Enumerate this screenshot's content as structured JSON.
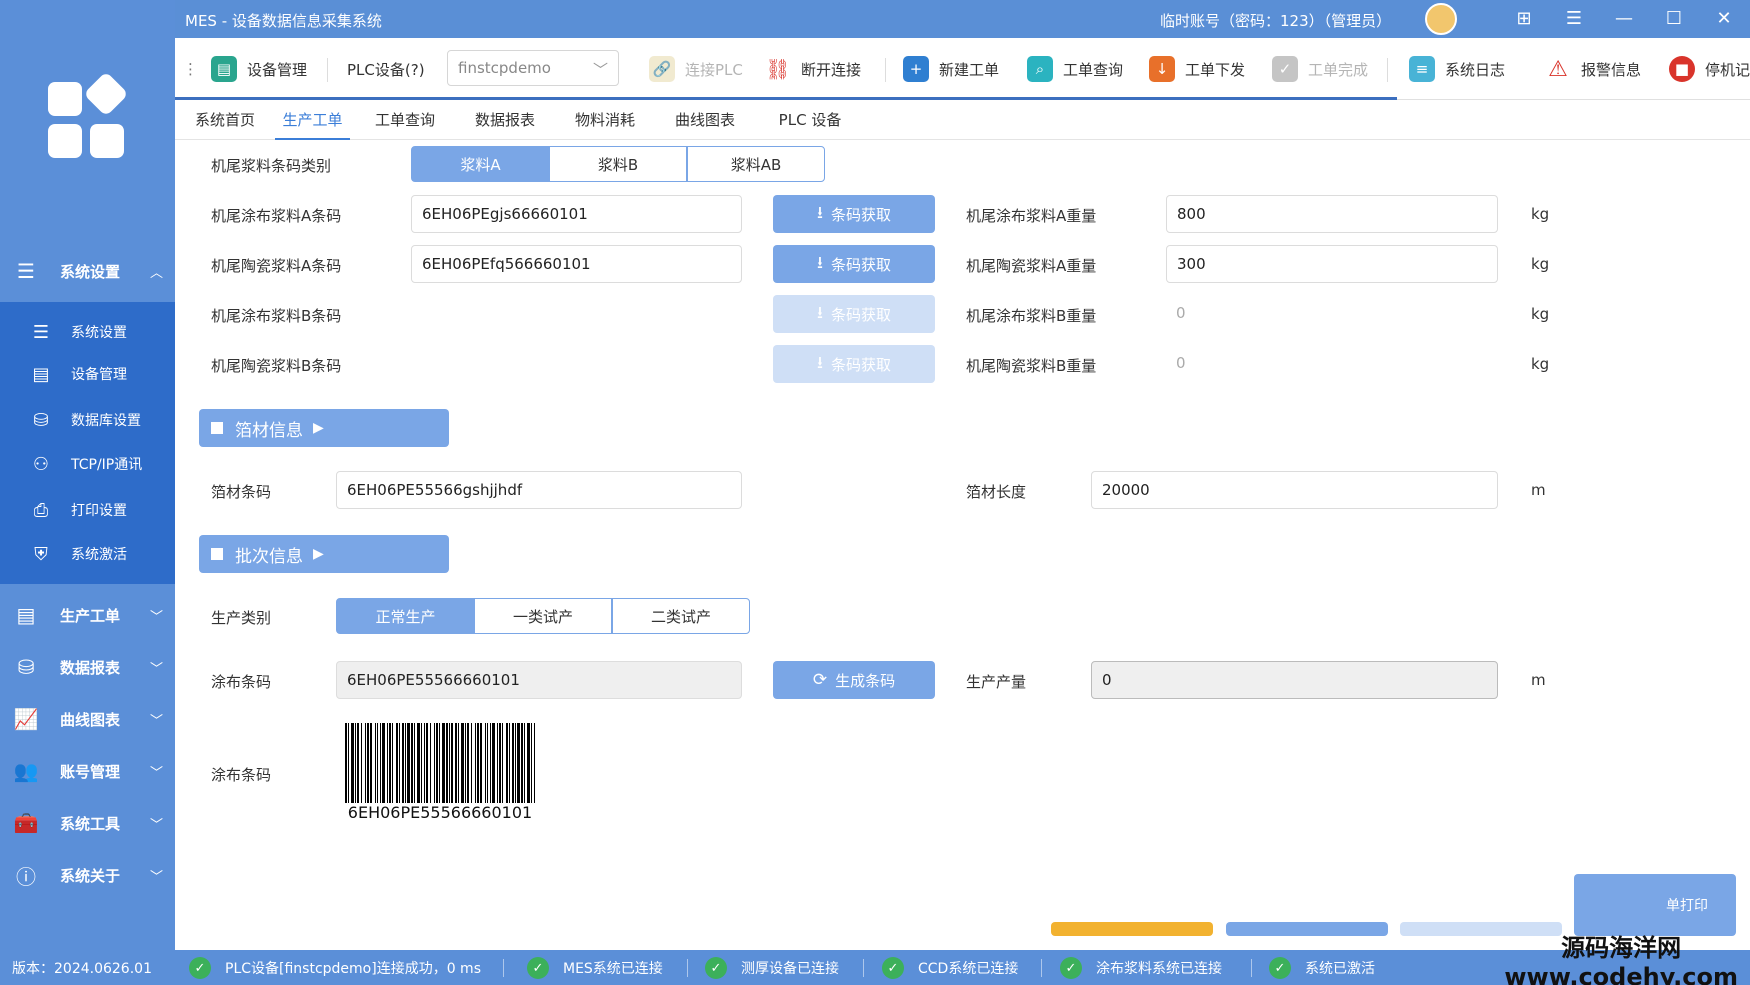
{
  "window": {
    "title": "MES - 设备数据信息采集系统",
    "user": "临时账号（密码：123）（管理员）"
  },
  "sidebar": {
    "groups": [
      {
        "label": "系统设置",
        "icon": "menu-icon",
        "expanded": true
      },
      {
        "label": "生产工单",
        "icon": "document-icon"
      },
      {
        "label": "数据报表",
        "icon": "database-icon"
      },
      {
        "label": "曲线图表",
        "icon": "chart-icon"
      },
      {
        "label": "账号管理",
        "icon": "users-icon"
      },
      {
        "label": "系统工具",
        "icon": "toolbox-icon"
      },
      {
        "label": "系统关于",
        "icon": "info-icon"
      }
    ],
    "sub_items": [
      {
        "label": "系统设置",
        "icon": "menu-icon"
      },
      {
        "label": "设备管理",
        "icon": "server-icon"
      },
      {
        "label": "数据库设置",
        "icon": "database-icon"
      },
      {
        "label": "TCP/IP通讯",
        "icon": "network-icon"
      },
      {
        "label": "打印设置",
        "icon": "printer-icon"
      },
      {
        "label": "系统激活",
        "icon": "shield-check-icon"
      }
    ],
    "version": "版本：2024.0626.01"
  },
  "toolbar": {
    "device_mgmt": "设备管理",
    "plc_label": "PLC设备(?)",
    "plc_value": "finstcpdemo",
    "connect_plc": "连接PLC",
    "disconnect": "断开连接",
    "new_order": "新建工单",
    "order_query": "工单查询",
    "order_issue": "工单下发",
    "order_done": "工单完成",
    "sys_log": "系统日志",
    "alarm": "报警信息",
    "stop": "停机记"
  },
  "tabs": [
    "系统首页",
    "生产工单",
    "工单查询",
    "数据报表",
    "物料消耗",
    "曲线图表",
    "PLC 设备"
  ],
  "form": {
    "slurry_type_label": "机尾浆料条码类别",
    "slurry_types": [
      "浆料A",
      "浆料B",
      "浆料AB"
    ],
    "rows": [
      {
        "label": "机尾涂布浆料A条码",
        "value": "6EH06PEgjs66660101",
        "weight_label": "机尾涂布浆料A重量",
        "weight": "800"
      },
      {
        "label": "机尾陶瓷浆料A条码",
        "value": "6EH06PEfq566660101",
        "weight_label": "机尾陶瓷浆料A重量",
        "weight": "300"
      },
      {
        "label": "机尾涂布浆料B条码",
        "value": "",
        "weight_label": "机尾涂布浆料B重量",
        "weight": "0"
      },
      {
        "label": "机尾陶瓷浆料B条码",
        "value": "",
        "weight_label": "机尾陶瓷浆料B重量",
        "weight": "0"
      }
    ],
    "fetch_button": "条码获取",
    "unit_kg": "kg",
    "foil_section": "箔材信息",
    "foil_code_label": "箔材条码",
    "foil_code": "6EH06PE55566gshjjhdf",
    "foil_length_label": "箔材长度",
    "foil_length": "20000",
    "unit_m": "m",
    "batch_section": "批次信息",
    "prod_type_label": "生产类别",
    "prod_types": [
      "正常生产",
      "一类试产",
      "二类试产"
    ],
    "coat_code_label": "涂布条码",
    "coat_code": "6EH06PE55566660101",
    "gen_button": "生成条码",
    "output_label": "生产产量",
    "output": "0",
    "barcode_label": "涂布条码",
    "barcode_text": "6EH06PE55566660101",
    "print_button": "单打印"
  },
  "statusbar": [
    "PLC设备[finstcpdemo]连接成功，0 ms",
    "MES系统已连接",
    "测厚设备已连接",
    "CCD系统已连接",
    "涂布浆料系统已连接",
    "系统已激活"
  ],
  "watermark": {
    "line1": "源码海洋网",
    "line2": "www.codehy.com"
  },
  "colors": {
    "sidebar": "#5b8fd8",
    "accent": "#7aa6e6",
    "active_sub": "#2e6cc9",
    "ok": "#3cb05a"
  }
}
